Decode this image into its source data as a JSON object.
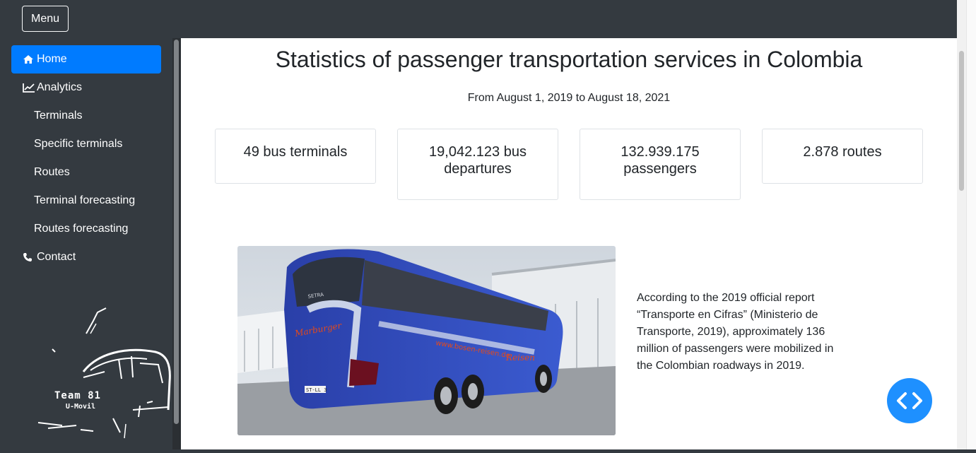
{
  "topbar": {
    "menu_label": "Menu"
  },
  "sidebar": {
    "items": [
      {
        "label": "Home",
        "icon": "home-icon",
        "active": true
      },
      {
        "label": "Analytics",
        "icon": "chart-line-icon"
      },
      {
        "label": "Terminals"
      },
      {
        "label": "Specific terminals"
      },
      {
        "label": "Routes"
      },
      {
        "label": "Terminal forecasting"
      },
      {
        "label": "Routes forecasting"
      },
      {
        "label": "Contact",
        "icon": "phone-icon"
      }
    ],
    "logo": {
      "line1": "Team 81",
      "line2": "U-Movil"
    }
  },
  "main": {
    "title": "Statistics of passenger transportation services in Colombia",
    "subtitle": "From August 1, 2019 to August 18, 2021",
    "cards": [
      {
        "text": "49 bus terminals"
      },
      {
        "text": "19,042.123 bus departures"
      },
      {
        "text": "132.939.175 passengers"
      },
      {
        "text": "2.878 routes"
      }
    ],
    "image": {
      "bus_brand": "SETRA",
      "bus_text": "Marburger Reisen",
      "bus_web": "www.bosen-reisen.de",
      "plate": "ST-LL 3"
    },
    "description": "According to the 2019 official report “Transporte en Cifras” (Ministerio de Transporte, 2019), approximately 136 million of passengers were mobilized in the Colombian roadways in 2019."
  },
  "colors": {
    "sidebar_bg": "#343a40",
    "active": "#007bff",
    "fab": "#1e90ff"
  },
  "fab_icon": "code-icon"
}
